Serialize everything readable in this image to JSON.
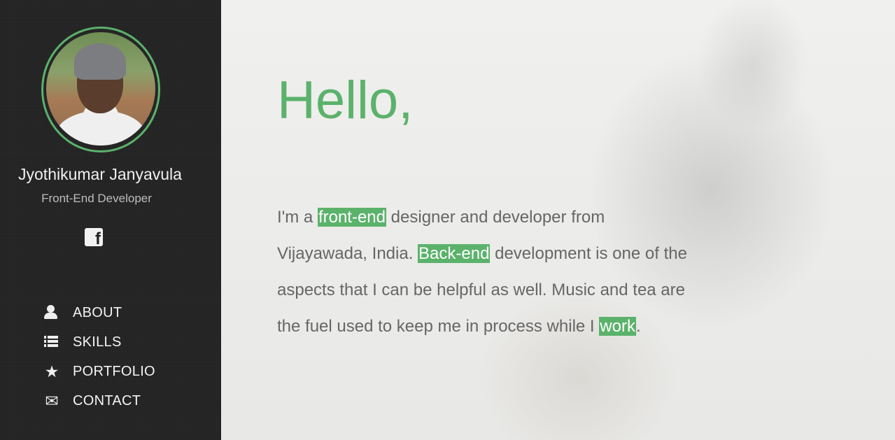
{
  "sidebar": {
    "name": "Jyothikumar Janyavula",
    "role": "Front-End Developer",
    "social": {
      "facebook_glyph": "f"
    },
    "nav": [
      {
        "label": "ABOUT",
        "icon": "user-icon"
      },
      {
        "label": "SKILLS",
        "icon": "list-icon"
      },
      {
        "label": "PORTFOLIO",
        "icon": "star-icon"
      },
      {
        "label": "CONTACT",
        "icon": "mail-icon"
      }
    ]
  },
  "main": {
    "title": "Hello,",
    "intro": {
      "p1": "I'm a ",
      "h1": "front-end",
      "p2": " designer and developer from Vijayawada, India. ",
      "h2": "Back-end",
      "p3": " development is one of the aspects that I can be helpful as well. Music and tea are the fuel used to keep me in process while I ",
      "h3": "work",
      "p4": "."
    }
  },
  "colors": {
    "accent": "#5bb26b",
    "sidebar_bg": "#222222",
    "text": "#666666"
  }
}
